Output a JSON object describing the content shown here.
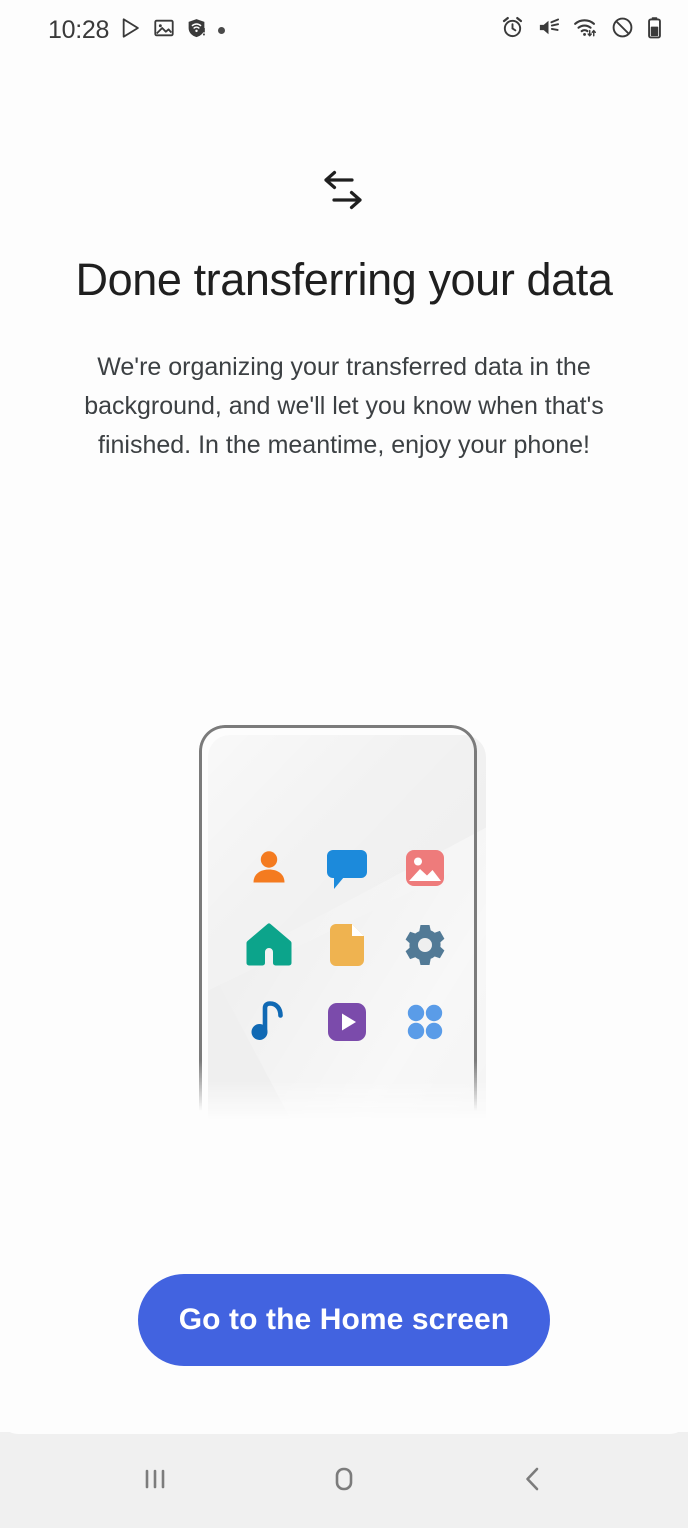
{
  "status_bar": {
    "time": "10:28",
    "left_icons": [
      {
        "name": "play-store-icon",
        "label": "Play Store"
      },
      {
        "name": "gallery-image-icon",
        "label": "Image saved"
      },
      {
        "name": "secure-wifi-shield-icon",
        "label": "Secure Wi-Fi alert"
      },
      {
        "name": "notification-dot-icon",
        "label": "Notification"
      }
    ],
    "right_icons": [
      {
        "name": "alarm-clock-icon",
        "label": "Alarm set"
      },
      {
        "name": "mute-volume-icon",
        "label": "Sound muted"
      },
      {
        "name": "wifi-signal-icon",
        "label": "Wi-Fi connected"
      },
      {
        "name": "do-not-disturb-icon",
        "label": "Do not disturb"
      },
      {
        "name": "battery-icon",
        "label": "Battery"
      }
    ]
  },
  "main": {
    "hero_icon": "data-transfer-arrows-icon",
    "title": "Done transferring your data",
    "subtitle": "We're organizing your transferred data in the background, and we'll let you know when that's finished. In the meantime, enjoy your phone!",
    "illustration": {
      "name": "phone-with-apps-illustration",
      "apps": [
        {
          "name": "contacts-icon",
          "label": "Contacts",
          "color": "#F47B20"
        },
        {
          "name": "messages-icon",
          "label": "Messages",
          "color": "#1C8ADB"
        },
        {
          "name": "photos-icon",
          "label": "Photos",
          "color": "#EE7B7B"
        },
        {
          "name": "home-icon",
          "label": "Home",
          "color": "#0CA48B"
        },
        {
          "name": "documents-icon",
          "label": "Documents",
          "color": "#EFB350"
        },
        {
          "name": "settings-gear-icon",
          "label": "Settings",
          "color": "#527A96"
        },
        {
          "name": "music-note-icon",
          "label": "Music",
          "color": "#1069B4"
        },
        {
          "name": "video-play-icon",
          "label": "Video",
          "color": "#7B4BAB"
        },
        {
          "name": "apps-grid-icon",
          "label": "Apps",
          "color": "#5A9CE8"
        }
      ]
    }
  },
  "cta": {
    "label": "Go to the Home screen",
    "color": "#4263E0"
  },
  "nav_bar": {
    "buttons": [
      {
        "name": "recents-button",
        "label": "Recents"
      },
      {
        "name": "home-button",
        "label": "Home"
      },
      {
        "name": "back-button",
        "label": "Back"
      }
    ]
  }
}
